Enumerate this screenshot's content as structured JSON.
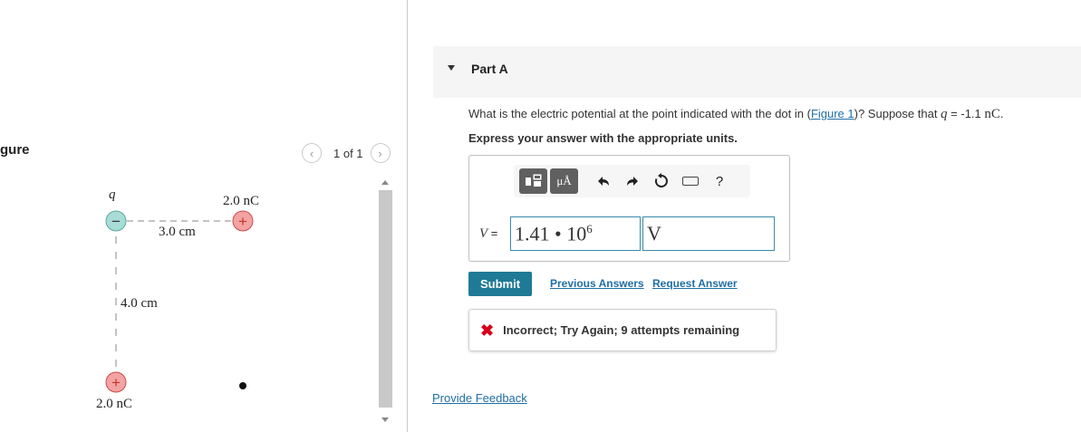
{
  "figure_pane": {
    "title": "gure",
    "pager": {
      "prev_icon": "‹",
      "text": "1 of 1",
      "next_icon": "›"
    },
    "labels": {
      "charge_q": "q",
      "charge_top_right": "2.0 nC",
      "distance_horizontal": "3.0 cm",
      "distance_vertical": "4.0 cm",
      "charge_bottom_left": "2.0 nC"
    },
    "signs": {
      "negative": "−",
      "positive": "+"
    }
  },
  "part": {
    "title": "Part A",
    "question": {
      "prefix": "What is the electric potential at the point indicated with the dot in (",
      "link": "Figure 1",
      "middle": ")? Suppose that ",
      "var": "q",
      "equals": " = -1.1 ",
      "unit": "nC",
      "suffix": "."
    },
    "instructions": "Express your answer with the appropriate units.",
    "answer": {
      "variable": "V",
      "equals": " =",
      "value_mantissa": "1.41 • 10",
      "value_exponent": "6",
      "unit": "V"
    },
    "toolbar": {
      "units_label": "μÅ",
      "help_label": "?"
    },
    "buttons": {
      "submit": "Submit",
      "previous_answers": "Previous Answers",
      "request_answer": "Request Answer"
    },
    "feedback": {
      "icon": "✖",
      "text": "Incorrect; Try Again; 9 attempts remaining"
    }
  },
  "provide_feedback": "Provide Feedback",
  "colors": {
    "link": "#1f6ea6",
    "submit_bg": "#1f7a96",
    "error": "#d9001b",
    "negative_charge_fill": "#a8dcd6",
    "positive_charge_fill": "#f4a3a3"
  }
}
